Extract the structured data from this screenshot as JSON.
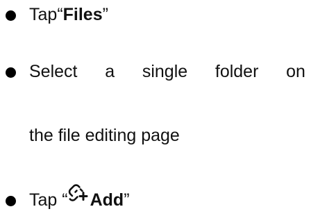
{
  "steps": [
    {
      "prefix": "Tap",
      "open_quote": "“",
      "bold": "Files",
      "close_quote": "”"
    },
    {
      "words": [
        "Select",
        "a",
        "single",
        "folder",
        "on"
      ],
      "continuation": "the file editing page"
    },
    {
      "prefix": "Tap “",
      "icon": "link-add-icon",
      "bold": "Add",
      "close_quote": "”"
    }
  ]
}
